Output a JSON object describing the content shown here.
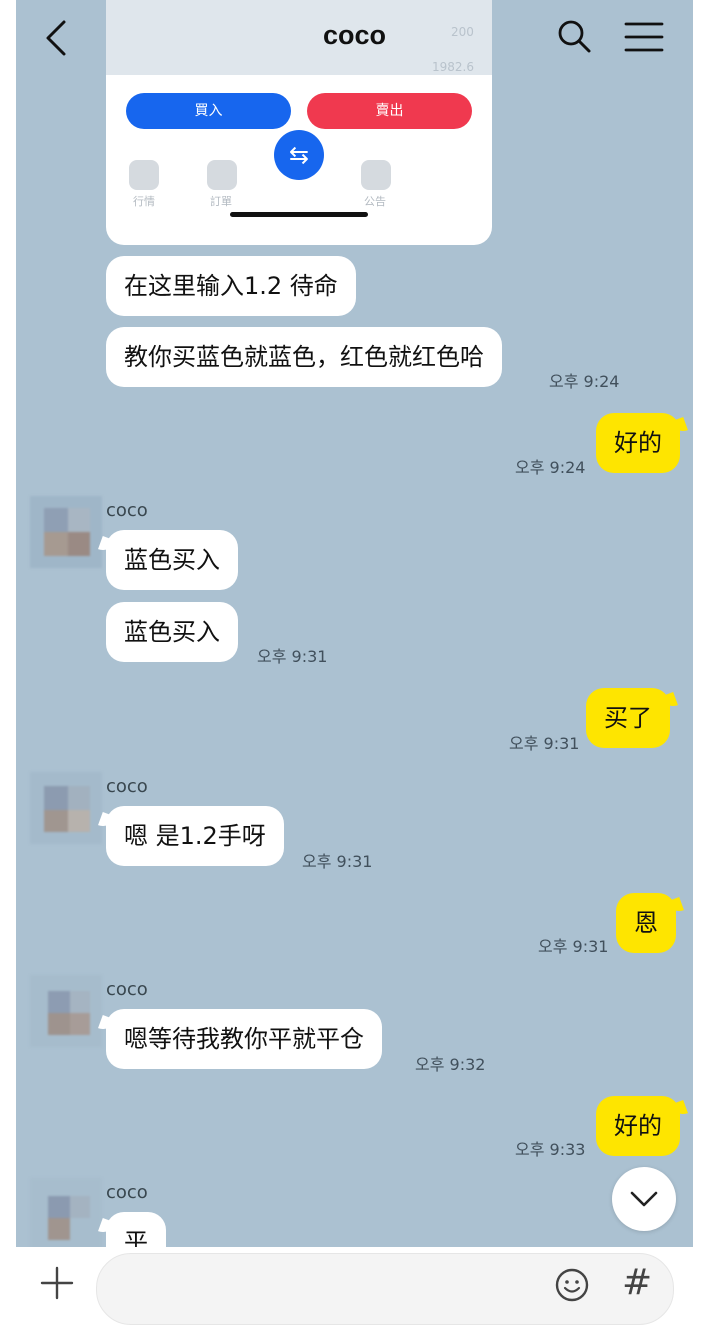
{
  "header": {
    "title": "coco"
  },
  "image_card": {
    "faded_rows": [
      "200",
      "1982.6"
    ],
    "buy_label": "買入",
    "sell_label": "賣出",
    "tabs": [
      "行情",
      "訂單",
      "公告"
    ]
  },
  "messages": [
    {
      "text": "在这里输入1.2 待命"
    },
    {
      "text": "教你买蓝色就蓝色，红色就红色哈",
      "time": "오후 9:24"
    },
    {
      "text": "好的",
      "time": "오후 9:24"
    },
    {
      "sender": "coco"
    },
    {
      "text": "蓝色买入"
    },
    {
      "text": "蓝色买入",
      "time": "오후 9:31"
    },
    {
      "text": "买了",
      "time": "오후 9:31"
    },
    {
      "sender": "coco",
      "text": "嗯  是1.2手呀",
      "time": "오후 9:31"
    },
    {
      "text": "恩",
      "time": "오후 9:31"
    },
    {
      "sender": "coco",
      "text": "嗯等待我教你平就平仓",
      "time": "오후 9:32"
    },
    {
      "text": "好的",
      "time": "오후 9:33"
    },
    {
      "sender": "coco",
      "text": "平"
    }
  ],
  "input": {
    "placeholder": "",
    "hash_label": "#"
  },
  "colors": {
    "chat_bg": "#abc1d1",
    "my_bubble": "#fee500",
    "their_bubble": "#ffffff",
    "buy": "#1766ee",
    "sell": "#f0394f"
  }
}
